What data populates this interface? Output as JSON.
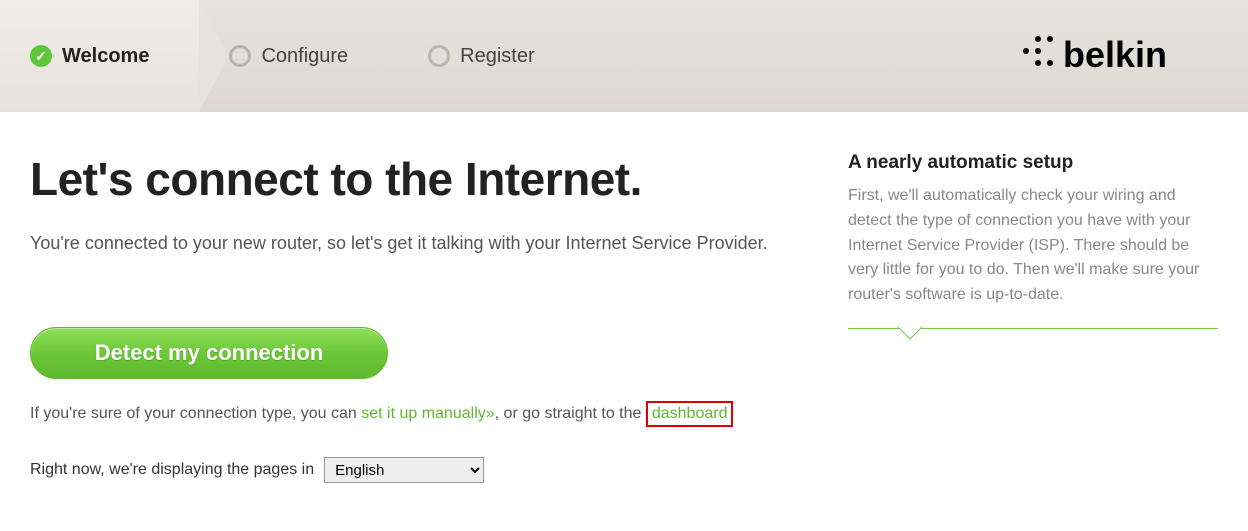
{
  "tabs": {
    "welcome": "Welcome",
    "configure": "Configure",
    "register": "Register"
  },
  "brand": "belkin",
  "main": {
    "heading": "Let's connect to the Internet.",
    "subtitle": "You're connected to your new router, so let's get it talking with your Internet Service Provider.",
    "detect_button": "Detect my connection",
    "manual_prefix": "If you're sure of your connection type, you can ",
    "manual_link": "set it up manually»",
    "manual_mid": ", or go straight to the ",
    "dashboard_link": "dashboard",
    "lang_prefix": "Right now, we're displaying the pages in",
    "language": "English"
  },
  "aside": {
    "title": "A nearly automatic setup",
    "body": "First, we'll automatically check your wiring and detect the type of connection you have with your Internet Service Provider (ISP). There should be very little for you to do. Then we'll make sure your router's software is up-to-date."
  }
}
